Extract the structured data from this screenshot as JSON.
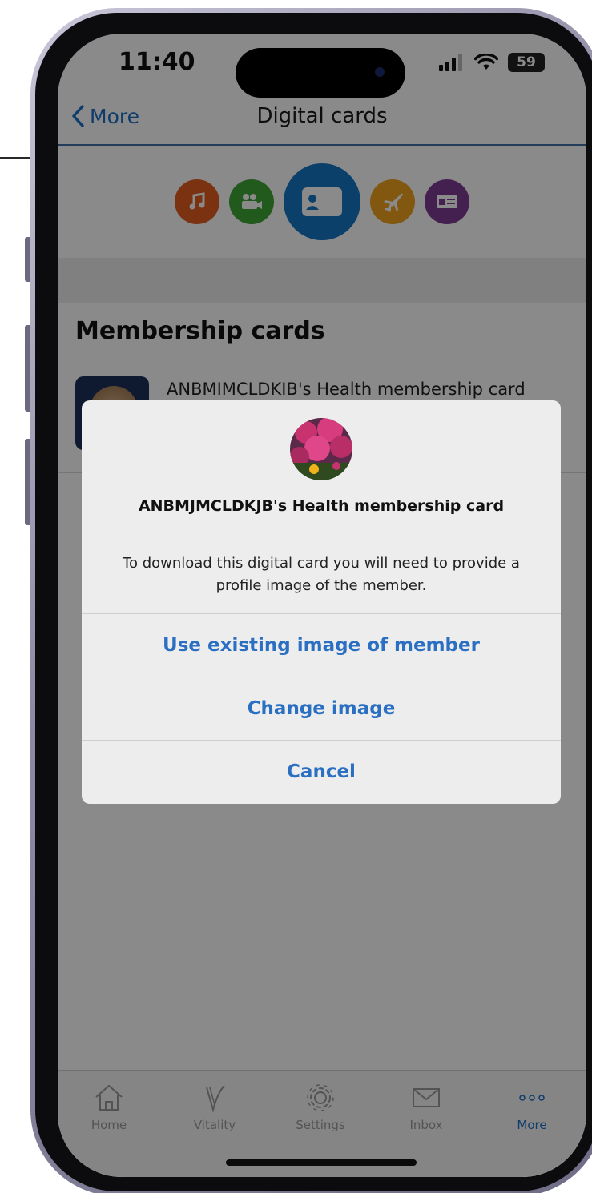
{
  "status_bar": {
    "time": "11:40",
    "battery": "59"
  },
  "nav": {
    "back_label": "More",
    "title": "Digital cards"
  },
  "categories": [
    {
      "icon": "music-note-icon",
      "color": "#e15d1e"
    },
    {
      "icon": "video-camera-icon",
      "color": "#3fa535"
    },
    {
      "icon": "id-card-icon",
      "color": "#1576c6",
      "selected": true
    },
    {
      "icon": "airplane-icon",
      "color": "#f0a11d"
    },
    {
      "icon": "ticket-card-icon",
      "color": "#7d3c94"
    }
  ],
  "section": {
    "title": "Membership cards"
  },
  "card_list": [
    {
      "name": "ANBMIMCLDKIB's Health membership card"
    }
  ],
  "dialog": {
    "title": "ANBMJMCLDKJB's Health membership card",
    "message": "To download this digital card you will need to provide a profile image of the member.",
    "buttons": [
      {
        "label": "Use existing image of member"
      },
      {
        "label": "Change image"
      },
      {
        "label": "Cancel"
      }
    ]
  },
  "tab_bar": {
    "tabs": [
      {
        "label": "Home",
        "icon": "house-icon"
      },
      {
        "label": "Vitality",
        "icon": "vitality-v-icon"
      },
      {
        "label": "Settings",
        "icon": "gear-icon"
      },
      {
        "label": "Inbox",
        "icon": "envelope-icon"
      },
      {
        "label": "More",
        "icon": "more-dots-icon",
        "active": true
      }
    ]
  },
  "colors": {
    "accent": "#1e6fc7",
    "nav_border": "#3f6fa6",
    "dialog_button": "#2a6fc2"
  }
}
